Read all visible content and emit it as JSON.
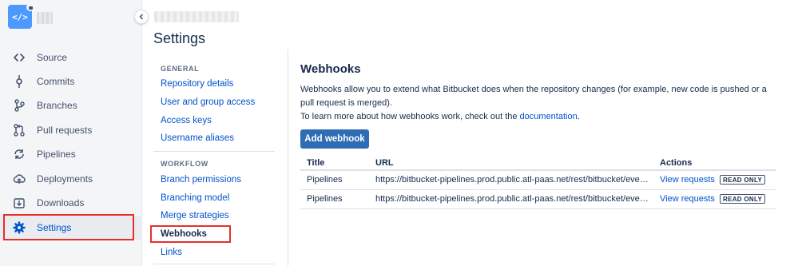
{
  "sidebar": {
    "repo_avatar_glyph": "</>",
    "collapse_icon": "chevron-left-icon",
    "items": [
      {
        "label": "Source",
        "icon": "code-icon"
      },
      {
        "label": "Commits",
        "icon": "commit-icon"
      },
      {
        "label": "Branches",
        "icon": "branch-icon"
      },
      {
        "label": "Pull requests",
        "icon": "pull-request-icon"
      },
      {
        "label": "Pipelines",
        "icon": "pipelines-icon"
      },
      {
        "label": "Deployments",
        "icon": "cloud-icon"
      },
      {
        "label": "Downloads",
        "icon": "download-icon"
      },
      {
        "label": "Settings",
        "icon": "gear-icon",
        "active": true
      }
    ]
  },
  "settings": {
    "title": "Settings",
    "sections": [
      {
        "header": "GENERAL",
        "links": [
          "Repository details",
          "User and group access",
          "Access keys",
          "Username aliases"
        ]
      },
      {
        "header": "WORKFLOW",
        "links": [
          "Branch permissions",
          "Branching model",
          "Merge strategies",
          "Webhooks",
          "Links"
        ]
      }
    ],
    "current": "Webhooks"
  },
  "main": {
    "title": "Webhooks",
    "description": "Webhooks allow you to extend what Bitbucket does when the repository changes (for example, new code is pushed or a pull request is merged).",
    "learn_more_prefix": "To learn more about how webhooks work, check out the ",
    "learn_more_link": "documentation",
    "learn_more_suffix": ".",
    "add_button": "Add webhook",
    "table": {
      "headers": [
        "Title",
        "URL",
        "Actions"
      ],
      "rows": [
        {
          "title": "Pipelines",
          "url": "https://bitbucket-pipelines.prod.public.atl-paas.net/rest/bitbucket/even...",
          "action": "View requests",
          "badge": "READ ONLY"
        },
        {
          "title": "Pipelines",
          "url": "https://bitbucket-pipelines.prod.public.atl-paas.net/rest/bitbucket/even...",
          "action": "View requests",
          "badge": "READ ONLY"
        }
      ]
    }
  },
  "colors": {
    "link": "#0052cc",
    "primary_button": "#2e6db4",
    "highlight": "#e8302b",
    "sidebar_bg": "#f4f5f7",
    "avatar": "#4c9aff"
  }
}
